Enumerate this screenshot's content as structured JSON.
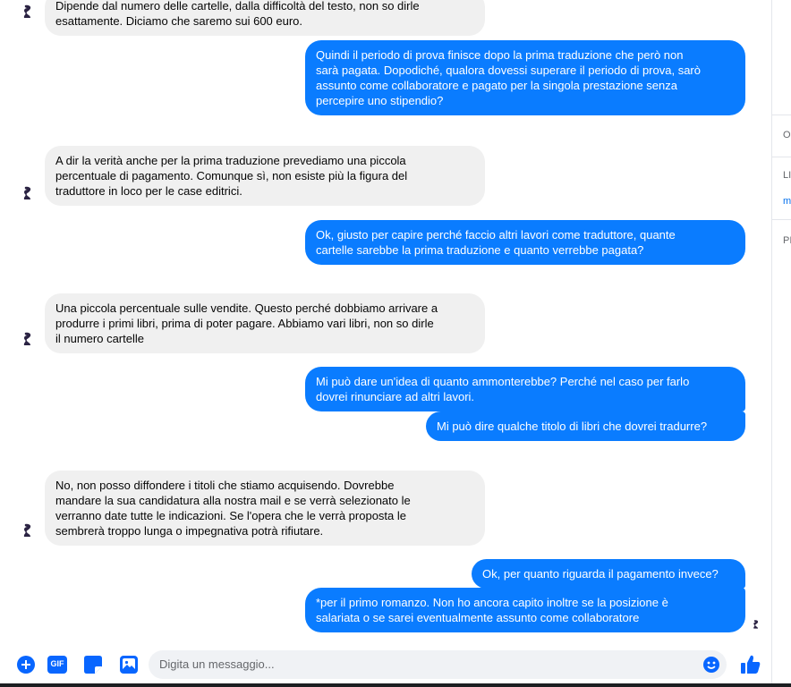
{
  "messages": [
    {
      "id": "m0",
      "dir": "in",
      "text": "Dipende dal numero delle cartelle, dalla difficoltà del testo, non so dirle\nesattamente. Diciamo che saremo sui 600 euro."
    },
    {
      "id": "m1",
      "dir": "out",
      "text": "Quindi il periodo di prova finisce dopo la prima traduzione che però non\nsarà pagata. Dopodiché, qualora dovessi superare il periodo di prova, sarò\nassunto come collaboratore e pagato per la singola prestazione senza\npercepire uno stipendio?"
    },
    {
      "id": "m2",
      "dir": "in",
      "text": "A dir la verità anche per la prima traduzione prevediamo una piccola\npercentuale di pagamento. Comunque sì, non esiste più la figura del\ntraduttore in loco per le case editrici."
    },
    {
      "id": "m3",
      "dir": "out",
      "text": "Ok, giusto per capire perché faccio altri lavori come traduttore, quante\ncartelle sarebbe la prima traduzione e quanto verrebbe pagata?"
    },
    {
      "id": "m4",
      "dir": "in",
      "text": "Una piccola percentuale sulle vendite. Questo perché dobbiamo arrivare a\nprodurre i primi libri, prima di poter pagare. Abbiamo vari libri, non so dirle\nil numero cartelle"
    },
    {
      "id": "m5",
      "dir": "out",
      "text": "Mi può dare un'idea di quanto ammonterebbe? Perché nel caso per farlo\ndovrei rinunciare ad altri lavori."
    },
    {
      "id": "m6",
      "dir": "out",
      "text": "Mi può dire qualche titolo di libri che dovrei  tradurre?"
    },
    {
      "id": "m7",
      "dir": "in",
      "text": "No, non posso diffondere i titoli che stiamo acquisendo. Dovrebbe\nmandare la sua candidatura alla nostra mail e se verrà selezionato le\nverranno date tutte le indicazioni. Se l'opera che le verrà proposta le\nsembrerà troppo lunga o impegnativa potrà rifiutare."
    },
    {
      "id": "m8",
      "dir": "out",
      "text": "Ok, per quanto riguarda il pagamento invece?"
    },
    {
      "id": "m9",
      "dir": "out",
      "text": "*per il primo romanzo. Non ho ancora capito inoltre se la posizione è\nsalariata o se sarei eventualmente assunto come collaboratore"
    }
  ],
  "composer": {
    "placeholder": "Digita un messaggio...",
    "gif_label": "GIF"
  },
  "right_panel": {
    "item1": "O",
    "item2": "LI",
    "item3": "m",
    "item4": "PI"
  },
  "colors": {
    "outgoing": "#0a7cff",
    "incoming": "#f0f0f0",
    "accent": "#0866ff"
  },
  "icons": [
    "plus-icon",
    "gif-icon",
    "sticker-icon",
    "image-icon",
    "emoji-icon",
    "like-icon",
    "avatar-icon",
    "read-receipt-icon"
  ]
}
